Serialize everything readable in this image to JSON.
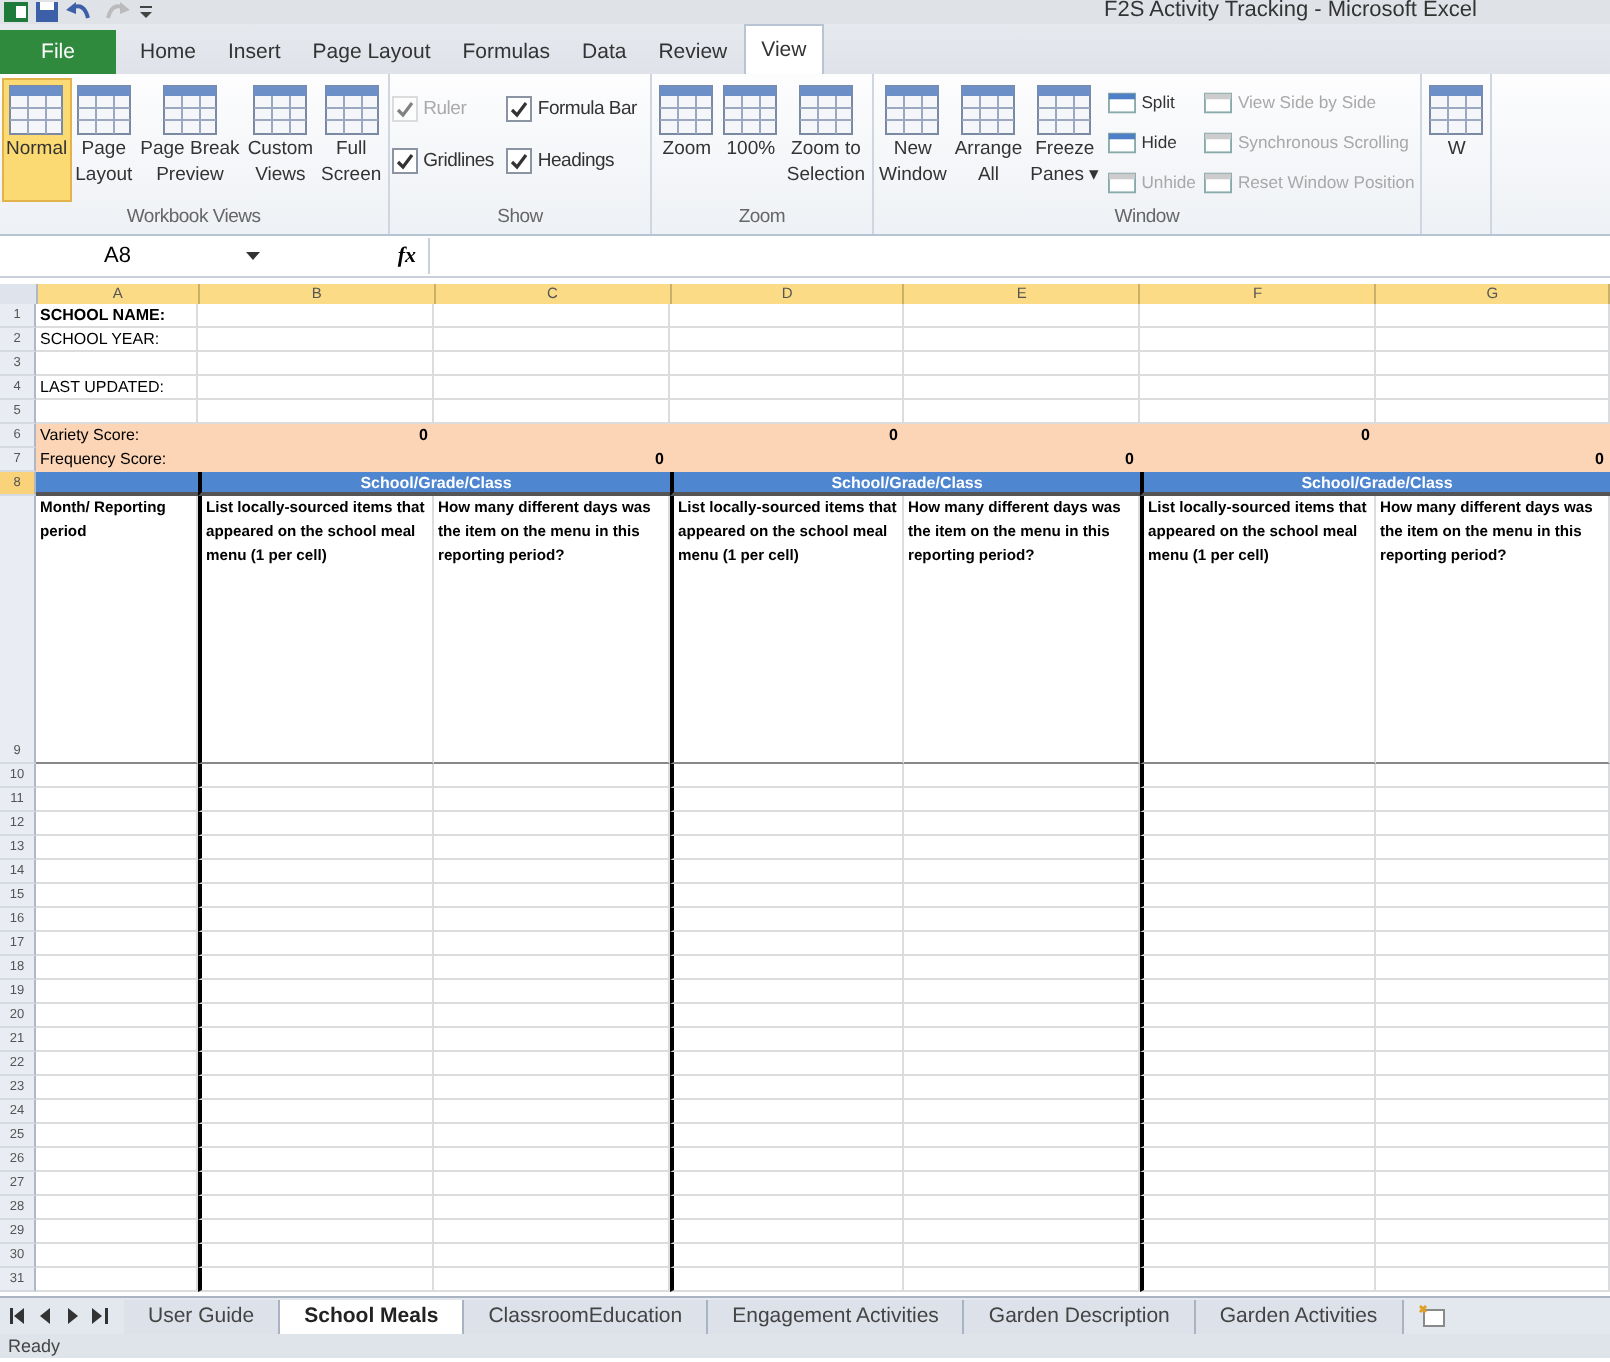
{
  "window": {
    "title": "F2S Activity Tracking - Microsoft Excel"
  },
  "ribbon": {
    "tabs": [
      {
        "label": "File",
        "kind": "file",
        "selected": false
      },
      {
        "label": "Home",
        "kind": "tab",
        "selected": false
      },
      {
        "label": "Insert",
        "kind": "tab",
        "selected": false
      },
      {
        "label": "Page Layout",
        "kind": "tab",
        "selected": false
      },
      {
        "label": "Formulas",
        "kind": "tab",
        "selected": false
      },
      {
        "label": "Data",
        "kind": "tab",
        "selected": false
      },
      {
        "label": "Review",
        "kind": "tab",
        "selected": false
      },
      {
        "label": "View",
        "kind": "tab",
        "selected": true
      }
    ],
    "groups": [
      {
        "title": "Workbook Views",
        "columns": [
          [
            {
              "kind": "large",
              "label_lines": [
                "Normal"
              ],
              "selected": true
            }
          ],
          [
            {
              "kind": "large",
              "label_lines": [
                "Page",
                "Layout"
              ],
              "selected": false
            }
          ],
          [
            {
              "kind": "large",
              "label_lines": [
                "Page Break",
                "Preview"
              ],
              "selected": false
            }
          ],
          [
            {
              "kind": "large",
              "label_lines": [
                "Custom",
                "Views"
              ],
              "selected": false
            }
          ],
          [
            {
              "kind": "large",
              "label_lines": [
                "Full",
                "Screen"
              ],
              "selected": false
            }
          ]
        ]
      },
      {
        "title": "Show",
        "columns": [
          [
            {
              "kind": "check",
              "label": "Ruler",
              "checked": true,
              "disabled": true
            },
            {
              "kind": "check",
              "label": "Gridlines",
              "checked": true,
              "disabled": false
            }
          ],
          [
            {
              "kind": "check",
              "label": "Formula Bar",
              "checked": true,
              "disabled": false
            },
            {
              "kind": "check",
              "label": "Headings",
              "checked": true,
              "disabled": false
            }
          ]
        ]
      },
      {
        "title": "Zoom",
        "columns": [
          [
            {
              "kind": "large",
              "label_lines": [
                "Zoom"
              ],
              "selected": false
            }
          ],
          [
            {
              "kind": "large",
              "label_lines": [
                "100%"
              ],
              "selected": false
            }
          ],
          [
            {
              "kind": "large",
              "label_lines": [
                "Zoom to",
                "Selection"
              ],
              "selected": false
            }
          ]
        ]
      },
      {
        "title": "Window",
        "columns": [
          [
            {
              "kind": "large",
              "label_lines": [
                "New",
                "Window"
              ],
              "selected": false
            }
          ],
          [
            {
              "kind": "large",
              "label_lines": [
                "Arrange",
                "All"
              ],
              "selected": false
            }
          ],
          [
            {
              "kind": "large",
              "label_lines": [
                "Freeze",
                "Panes ▾"
              ],
              "selected": false
            }
          ],
          [
            {
              "kind": "small",
              "label": "Split",
              "disabled": false
            },
            {
              "kind": "small",
              "label": "Hide",
              "disabled": false
            },
            {
              "kind": "small",
              "label": "Unhide",
              "disabled": true
            }
          ],
          [
            {
              "kind": "small",
              "label": "View Side by Side",
              "disabled": true
            },
            {
              "kind": "small",
              "label": "Synchronous Scrolling",
              "disabled": true
            },
            {
              "kind": "small",
              "label": "Reset Window Position",
              "disabled": true
            }
          ]
        ]
      },
      {
        "columns": [
          [
            {
              "kind": "large",
              "label_lines": [
                "W"
              ],
              "selected": false
            }
          ]
        ]
      }
    ]
  },
  "formula_bar": {
    "name_box": "A8",
    "function_symbol": "fx"
  },
  "sheet": {
    "columns": [
      "A",
      "B",
      "C",
      "D",
      "E",
      "F",
      "G"
    ],
    "rows": [
      {
        "number": "1",
        "kind": "info",
        "selected": false,
        "cells": [
          {
            "text": "SCHOOL NAME:",
            "bold": true
          }
        ]
      },
      {
        "number": "2",
        "kind": "info",
        "selected": false,
        "cells": [
          {
            "text": "SCHOOL YEAR:",
            "bold": false
          }
        ]
      },
      {
        "number": "3",
        "kind": "info",
        "selected": false
      },
      {
        "number": "4",
        "kind": "info",
        "selected": false,
        "cells": [
          {
            "text": "LAST UPDATED:",
            "bold": false
          }
        ]
      },
      {
        "number": "5",
        "kind": "info",
        "selected": false
      },
      {
        "number": "6",
        "kind": "score",
        "selected": false,
        "cells": [
          {
            "text": "Variety Score:"
          },
          {
            "text": "0"
          },
          {},
          {
            "text": "0"
          },
          {},
          {
            "text": "0"
          },
          {}
        ]
      },
      {
        "number": "7",
        "kind": "score",
        "selected": false,
        "cells": [
          {
            "text": "Frequency Score:"
          },
          {},
          {
            "text": "0"
          },
          {},
          {
            "text": "0"
          },
          {},
          {
            "text": "0"
          }
        ]
      },
      {
        "number": "8",
        "kind": "band",
        "selected": true,
        "cells": [
          {},
          {
            "text": "School/Grade/Class"
          },
          {
            "text": "School/Grade/Class"
          },
          {
            "text": "School/Grade/Class"
          }
        ]
      },
      {
        "number": "9",
        "kind": "header",
        "selected": false,
        "cells": [
          {
            "text": "Month/ Reporting period"
          },
          {
            "text": "List locally-sourced items that appeared on the school meal menu (1 per cell)"
          },
          {
            "text": "How many different days was the item on the menu in this reporting period?"
          },
          {
            "text": "List locally-sourced items that appeared on the school meal menu (1 per cell)"
          },
          {
            "text": "How many different days was the item on the menu in this reporting period?"
          },
          {
            "text": "List locally-sourced items that appeared on the school meal menu (1 per cell)"
          },
          {
            "text": "How many different days was the item on the menu in this reporting period?"
          }
        ]
      },
      {
        "number": "10",
        "kind": "blank",
        "selected": false
      },
      {
        "number": "11",
        "kind": "blank",
        "selected": false
      },
      {
        "number": "12",
        "kind": "blank",
        "selected": false
      },
      {
        "number": "13",
        "kind": "blank",
        "selected": false
      },
      {
        "number": "14",
        "kind": "blank",
        "selected": false
      },
      {
        "number": "15",
        "kind": "blank",
        "selected": false
      },
      {
        "number": "16",
        "kind": "blank",
        "selected": false
      },
      {
        "number": "17",
        "kind": "blank",
        "selected": false
      },
      {
        "number": "18",
        "kind": "blank",
        "selected": false
      },
      {
        "number": "19",
        "kind": "blank",
        "selected": false
      },
      {
        "number": "20",
        "kind": "blank",
        "selected": false
      },
      {
        "number": "21",
        "kind": "blank",
        "selected": false
      },
      {
        "number": "22",
        "kind": "blank",
        "selected": false
      },
      {
        "number": "23",
        "kind": "blank",
        "selected": false
      },
      {
        "number": "24",
        "kind": "blank",
        "selected": false
      },
      {
        "number": "25",
        "kind": "blank",
        "selected": false
      },
      {
        "number": "26",
        "kind": "blank",
        "selected": false
      },
      {
        "number": "27",
        "kind": "blank",
        "selected": false
      },
      {
        "number": "28",
        "kind": "blank",
        "selected": false
      },
      {
        "number": "29",
        "kind": "blank",
        "selected": false
      },
      {
        "number": "30",
        "kind": "blank",
        "selected": false
      },
      {
        "number": "31",
        "kind": "blank",
        "selected": false
      }
    ]
  },
  "sheet_tabs": [
    {
      "label": "User Guide",
      "selected": false
    },
    {
      "label": "School Meals",
      "selected": true
    },
    {
      "label": "ClassroomEducation",
      "selected": false
    },
    {
      "label": "Engagement Activities",
      "selected": false
    },
    {
      "label": "Garden Description",
      "selected": false
    },
    {
      "label": "Garden Activities",
      "selected": false
    }
  ],
  "status_bar": {
    "text": "Ready"
  }
}
